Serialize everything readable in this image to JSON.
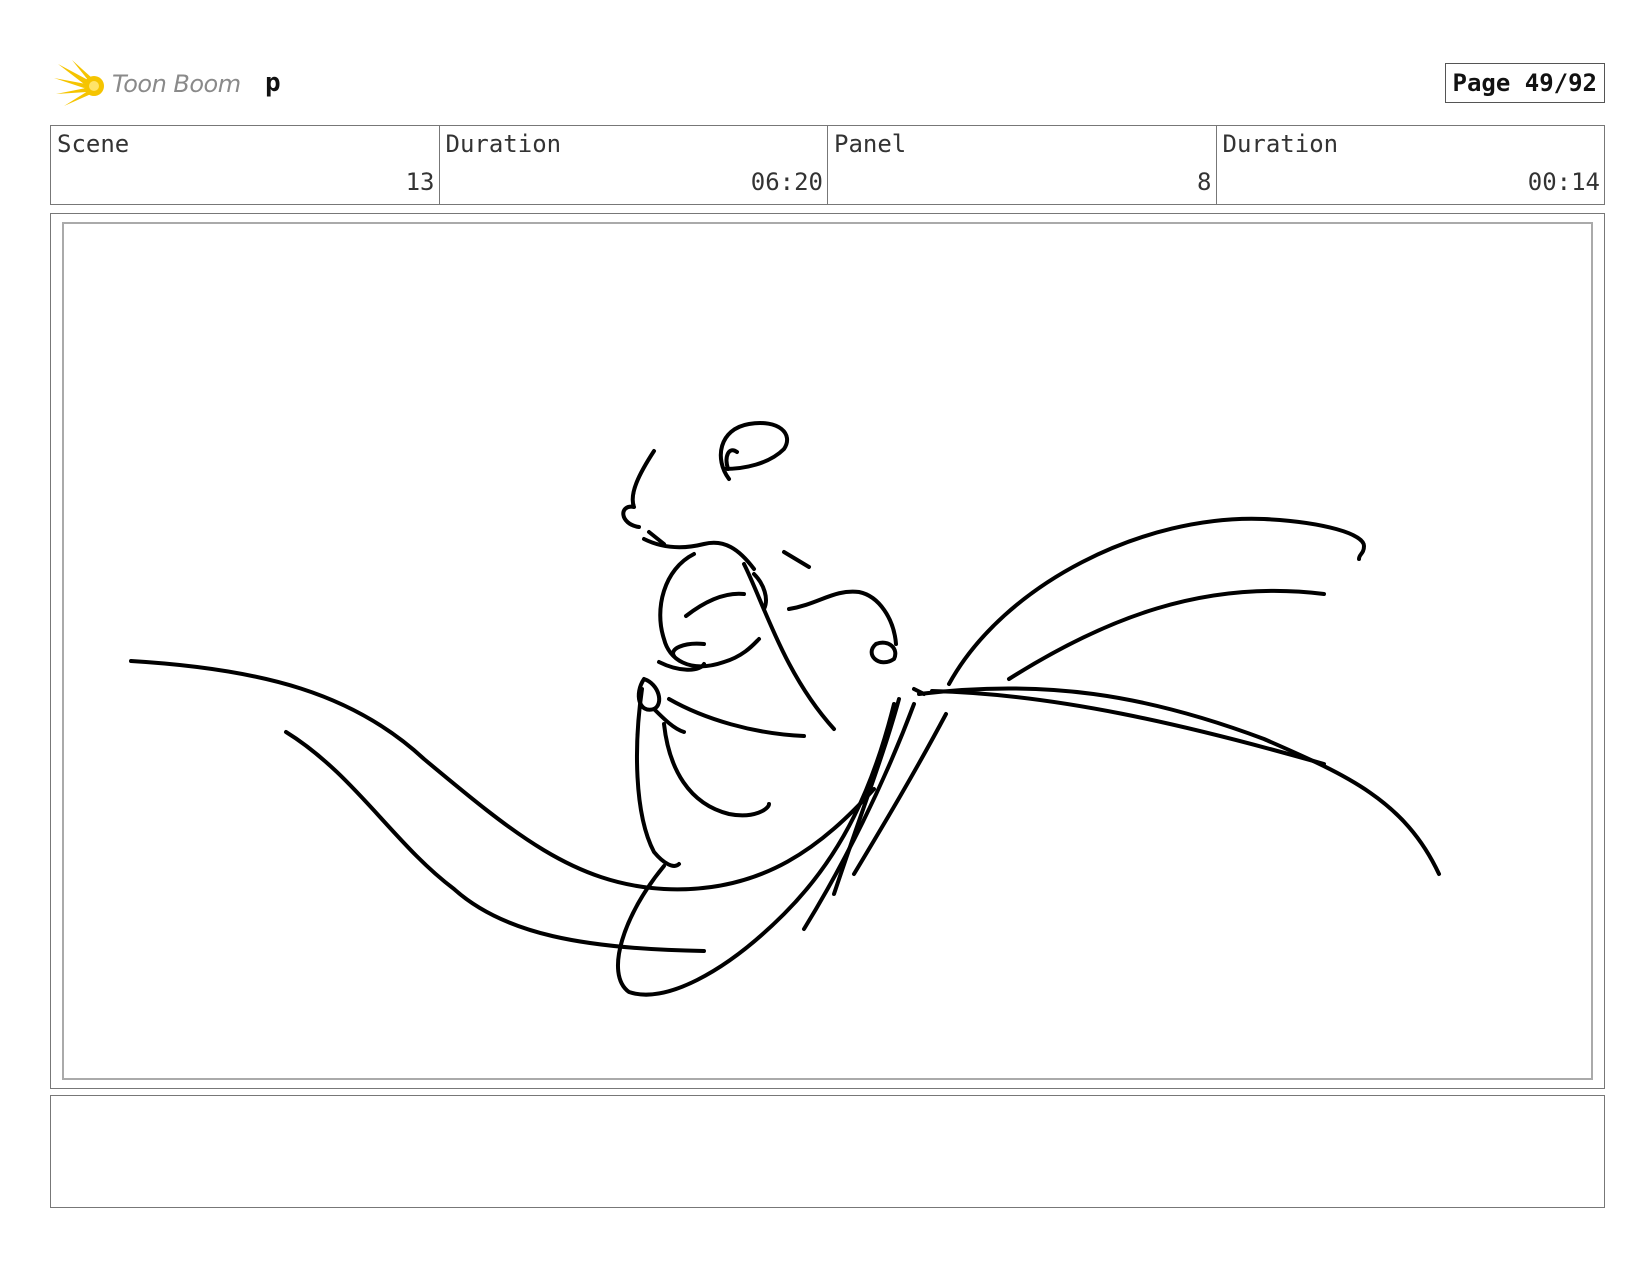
{
  "header": {
    "logo_text": "Toon Boom",
    "project_name": "p",
    "page_label": "Page 49/92",
    "logo_color": "#f5c400"
  },
  "info": [
    {
      "label": "Scene",
      "value": "13"
    },
    {
      "label": "Duration",
      "value": "06:20"
    },
    {
      "label": "Panel",
      "value": "8"
    },
    {
      "label": "Duration",
      "value": "00:14"
    }
  ],
  "panel": {
    "drawing_icon": "sketch-drawing",
    "stroke_color": "#000000"
  },
  "notes": {
    "text": ""
  }
}
